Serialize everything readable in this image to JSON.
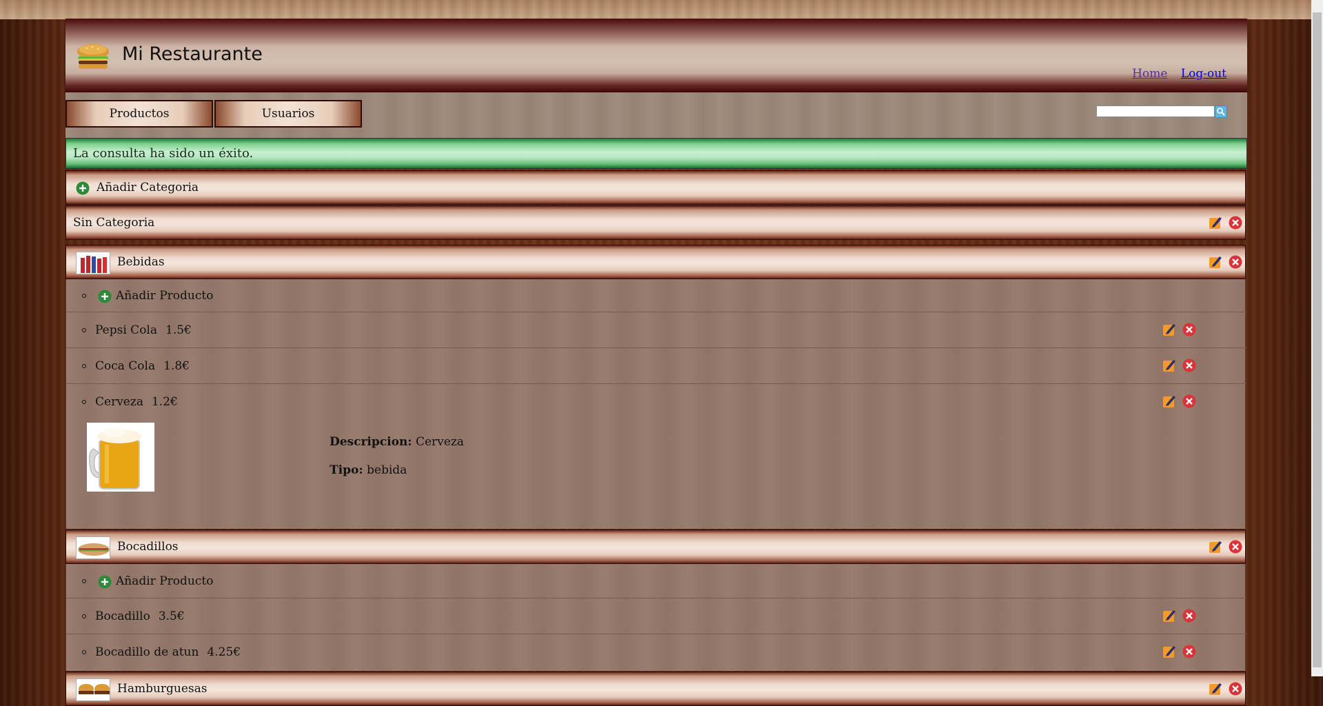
{
  "header": {
    "title": "Mi Restaurante",
    "home_link": "Home",
    "logout_link": "Log-out"
  },
  "nav": {
    "tab_productos": "Productos",
    "tab_usuarios": "Usuarios",
    "search_value": ""
  },
  "alert": {
    "message": "La consulta ha sido un éxito."
  },
  "add_category_label": "Añadir Categoria",
  "add_product_label": "Añadir Producto",
  "categories": [
    {
      "name": "Sin Categoria",
      "products": []
    },
    {
      "name": "Bebidas",
      "products": [
        {
          "name": "Pepsi Cola",
          "price": "1.5€"
        },
        {
          "name": "Coca Cola",
          "price": "1.8€"
        },
        {
          "name": "Cerveza",
          "price": "1.2€"
        }
      ],
      "expanded_product": {
        "desc_label": "Descripcion:",
        "desc_value": "Cerveza",
        "type_label": "Tipo:",
        "type_value": "bebida"
      }
    },
    {
      "name": "Bocadillos",
      "products": [
        {
          "name": "Bocadillo",
          "price": "3.5€"
        },
        {
          "name": "Bocadillo de atun",
          "price": "4.25€"
        }
      ]
    },
    {
      "name": "Hamburguesas",
      "products": []
    }
  ],
  "colors": {
    "edit_icon": "#f39a2b",
    "delete_icon": "#d8343a",
    "plus_icon": "#2e8a3a",
    "success_bg": "#b8e6c1"
  },
  "icons": [
    "burger-logo-icon",
    "plus-icon",
    "edit-icon",
    "delete-icon",
    "search-icon"
  ]
}
